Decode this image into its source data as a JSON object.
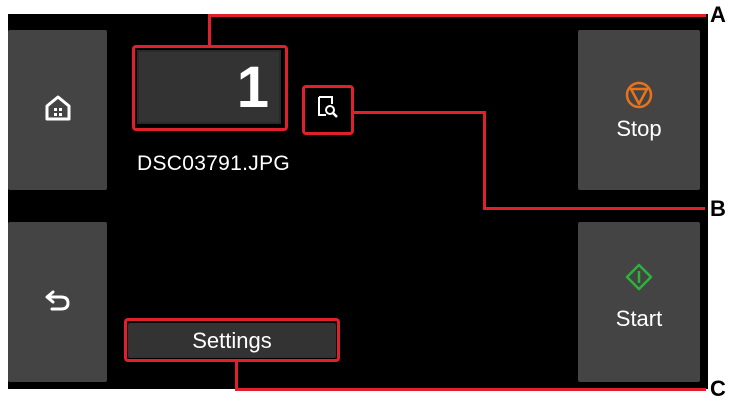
{
  "panel": {
    "copies_value": "1",
    "file_name": "DSC03791.JPG",
    "settings_label": "Settings",
    "stop_label": "Stop",
    "start_label": "Start"
  },
  "callouts": {
    "a": "A",
    "b": "B",
    "c": "C"
  },
  "icons": {
    "home": "home-icon",
    "back": "back-arrow-icon",
    "preview": "preview-magnifier-icon",
    "stop": "stop-icon",
    "start": "start-icon"
  },
  "colors": {
    "screen_bg": "#000000",
    "button_bg": "#444444",
    "highlight_red": "#e0202a",
    "stop_orange": "#e8731a",
    "start_green": "#2db23c"
  }
}
